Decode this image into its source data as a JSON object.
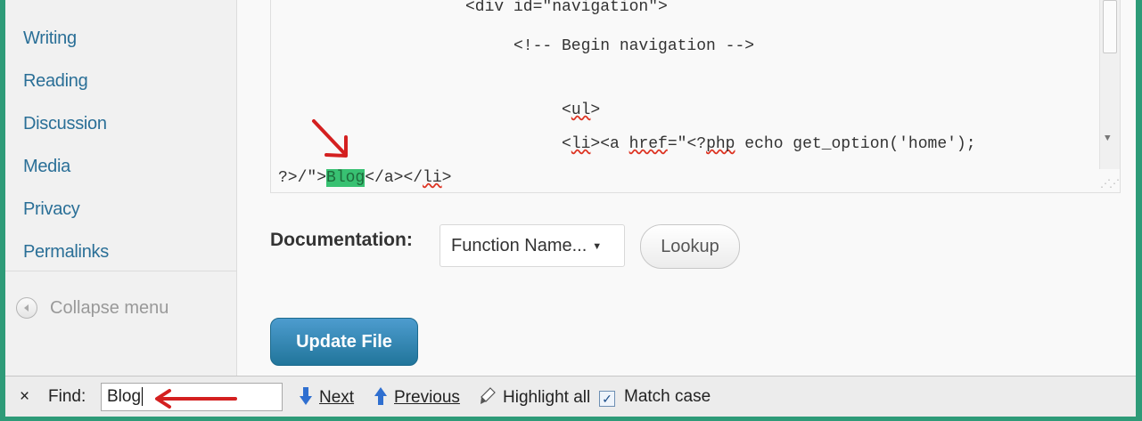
{
  "sidebar": {
    "items": [
      {
        "label": "Writing"
      },
      {
        "label": "Reading"
      },
      {
        "label": "Discussion"
      },
      {
        "label": "Media"
      },
      {
        "label": "Privacy"
      },
      {
        "label": "Permalinks"
      }
    ],
    "collapse_label": "Collapse menu"
  },
  "editor": {
    "line1": "<div id=\"navigation\">",
    "line2": "<!-- Begin navigation -->",
    "line3_open": "<",
    "line3_tag": "ul",
    "line3_close": ">",
    "line4_a": "<",
    "line4_tag": "li",
    "line4_b": "><a ",
    "line4_attr": "href",
    "line4_c": "=\"<?",
    "line4_php": "php",
    "line4_d": " echo get_option('home');",
    "line5_a": "?>/\">",
    "line5_highlight": "Blog",
    "line5_b": "</a></",
    "line5_tag": "li",
    "line5_c": ">"
  },
  "documentation": {
    "label": "Documentation:",
    "select_value": "Function Name...",
    "lookup_label": "Lookup"
  },
  "update_button": "Update File",
  "findbar": {
    "close": "×",
    "find_label": "Find:",
    "query": "Blog",
    "next": "Next",
    "previous": "Previous",
    "highlight_all": "Highlight all",
    "match_case": "Match case",
    "match_case_checked": true
  },
  "colors": {
    "link": "#2a6f97",
    "highlight": "#38c172",
    "update_button": "#21759b",
    "annotation_arrow": "#d42020"
  }
}
